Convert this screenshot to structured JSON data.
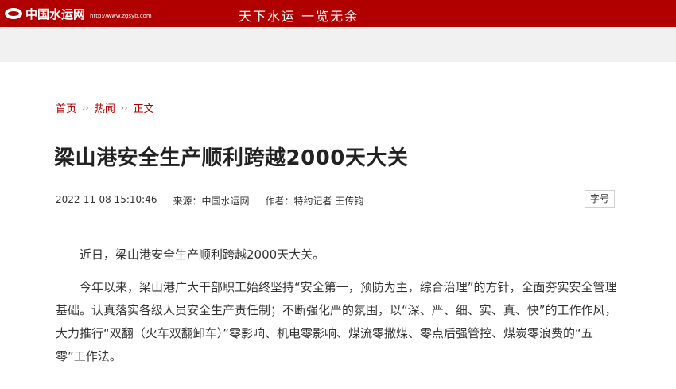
{
  "header": {
    "logo_name": "中国水运网",
    "logo_url": "http://www.zgsyb.com",
    "slogan": "天下水运  一览无余",
    "brand_color": "#b10000"
  },
  "breadcrumb": {
    "items": [
      "首页",
      "热闻",
      "正文"
    ],
    "separator": "››"
  },
  "article": {
    "title": "梁山港安全生产顺利跨越2000天大关",
    "datetime": "2022-11-08 15:10:46",
    "source": "来源：中国水运网",
    "author": "作者：特约记者 王传钧",
    "fontsize_label": "字号",
    "paragraphs": [
      "近日，梁山港安全生产顺利跨越2000天大关。",
      "今年以来，梁山港广大干部职工始终坚持“安全第一，预防为主，综合治理”的方针，全面夯实安全管理基础。认真落实各级人员安全生产责任制；不断强化严的氛围，以“深、严、细、实、真、快”的工作作风，大力推行“双翻（火车双翻卸车）”零影响、机电零影响、煤流零撒煤、零点后强管控、煤炭零浪费的“五零”工作法。"
    ]
  }
}
